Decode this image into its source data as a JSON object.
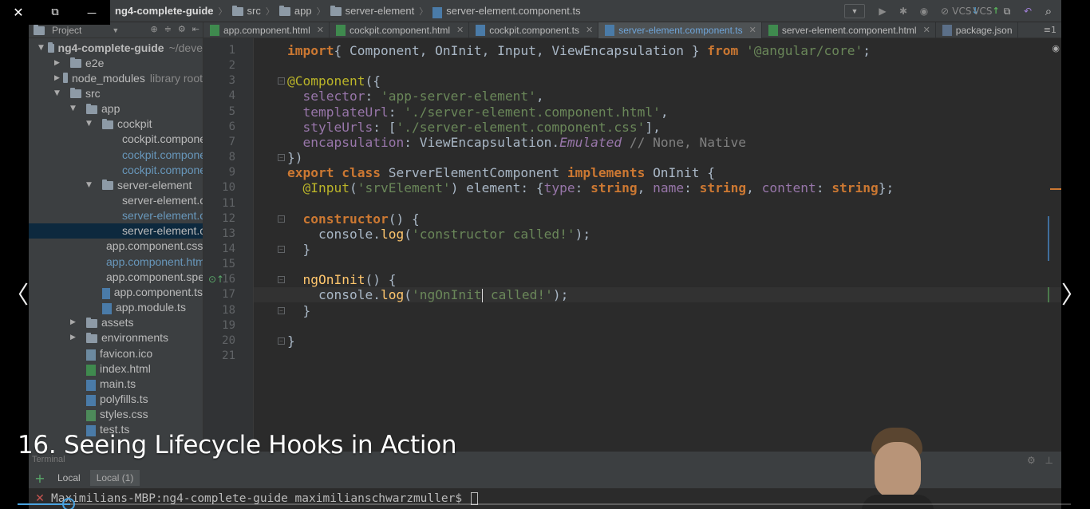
{
  "player": {
    "close_glyph": "✕",
    "restore_glyph": "⧉",
    "minimize_glyph": "—",
    "caption": "16. Seeing Lifecycle Hooks in Action",
    "progress_fraction": 0.05,
    "prev_glyph": "〈",
    "next_glyph": "〉"
  },
  "breadcrumb": {
    "project": "ng4-complete-guide",
    "items": [
      "src",
      "app",
      "server-element"
    ],
    "file": "server-element.component.ts"
  },
  "toolbar": {
    "vcs_label": "VCS"
  },
  "project_panel": {
    "title": "Project",
    "tree": [
      {
        "label": "ng4-complete-guide",
        "suffix": "~/deve",
        "arrow": "▼",
        "type": "folder"
      },
      {
        "label": "e2e",
        "arrow": "▶",
        "type": "folder"
      },
      {
        "label": "node_modules",
        "suffix": "library root",
        "arrow": "▶",
        "type": "folder"
      },
      {
        "label": "src",
        "arrow": "▼",
        "type": "folder"
      },
      {
        "label": "app",
        "arrow": "▼",
        "type": "folder"
      },
      {
        "label": "cockpit",
        "arrow": "▼",
        "type": "folder"
      },
      {
        "label": "cockpit.compone",
        "type": "css"
      },
      {
        "label": "cockpit.compone",
        "type": "html",
        "blue": true
      },
      {
        "label": "cockpit.compone",
        "type": "ts",
        "blue": true
      },
      {
        "label": "server-element",
        "arrow": "▼",
        "type": "folder"
      },
      {
        "label": "server-element.c",
        "type": "css"
      },
      {
        "label": "server-element.c",
        "type": "html",
        "blue": true
      },
      {
        "label": "server-element.c",
        "type": "ts",
        "selected": true
      },
      {
        "label": "app.component.css",
        "type": "css"
      },
      {
        "label": "app.component.htm",
        "type": "html",
        "blue": true
      },
      {
        "label": "app.component.spe",
        "type": "ts"
      },
      {
        "label": "app.component.ts",
        "type": "ts"
      },
      {
        "label": "app.module.ts",
        "type": "ts"
      },
      {
        "label": "assets",
        "arrow": "▶",
        "type": "folder"
      },
      {
        "label": "environments",
        "arrow": "▶",
        "type": "folder"
      },
      {
        "label": "favicon.ico",
        "type": "file"
      },
      {
        "label": "index.html",
        "type": "html"
      },
      {
        "label": "main.ts",
        "type": "ts"
      },
      {
        "label": "polyfills.ts",
        "type": "ts"
      },
      {
        "label": "styles.css",
        "type": "css"
      },
      {
        "label": "test.ts",
        "type": "ts"
      }
    ]
  },
  "tabs": [
    {
      "label": "app.component.html",
      "type": "html"
    },
    {
      "label": "cockpit.component.html",
      "type": "html"
    },
    {
      "label": "cockpit.component.ts",
      "type": "ts"
    },
    {
      "label": "server-element.component.ts",
      "type": "ts",
      "active": true
    },
    {
      "label": "server-element.component.html",
      "type": "html"
    },
    {
      "label": "package.json",
      "type": "json"
    }
  ],
  "tabs_more": "≡1",
  "code": [
    [
      [
        "kw",
        "import"
      ],
      [
        "",
        "{ Component, OnInit, Input, ViewEncapsulation } "
      ],
      [
        "kw",
        "from "
      ],
      [
        "str",
        "'@angular/core'"
      ],
      [
        "",
        ";"
      ]
    ],
    [],
    [
      [
        "dec",
        "@Component"
      ],
      [
        "",
        "({"
      ]
    ],
    [
      [
        "",
        "  "
      ],
      [
        "prop",
        "selector"
      ],
      [
        "",
        ": "
      ],
      [
        "str",
        "'app-server-element'"
      ],
      [
        "",
        ","
      ]
    ],
    [
      [
        "",
        "  "
      ],
      [
        "prop",
        "templateUrl"
      ],
      [
        "",
        ": "
      ],
      [
        "str",
        "'./server-element.component.html'"
      ],
      [
        "",
        ","
      ]
    ],
    [
      [
        "",
        "  "
      ],
      [
        "prop",
        "styleUrls"
      ],
      [
        "",
        ": ["
      ],
      [
        "str",
        "'./server-element.component.css'"
      ],
      [
        "",
        "],"
      ]
    ],
    [
      [
        "",
        "  "
      ],
      [
        "prop",
        "encapsulation"
      ],
      [
        "",
        ": ViewEncapsulation."
      ],
      [
        "it",
        "Emulated"
      ],
      [
        "cm",
        " // None, Native"
      ]
    ],
    [
      [
        "",
        "})"
      ]
    ],
    [
      [
        "kw",
        "export class "
      ],
      [
        "",
        "ServerElementComponent "
      ],
      [
        "kw",
        "implements "
      ],
      [
        "",
        "OnInit {"
      ]
    ],
    [
      [
        "",
        "  "
      ],
      [
        "dec",
        "@Input"
      ],
      [
        "",
        "("
      ],
      [
        "str",
        "'srvElement'"
      ],
      [
        "",
        ") element: {"
      ],
      [
        "prop",
        "type"
      ],
      [
        "",
        ": "
      ],
      [
        "type",
        "string"
      ],
      [
        "",
        ", "
      ],
      [
        "prop",
        "name"
      ],
      [
        "",
        ": "
      ],
      [
        "type",
        "string"
      ],
      [
        "",
        ", "
      ],
      [
        "prop",
        "content"
      ],
      [
        "",
        ": "
      ],
      [
        "type",
        "string"
      ],
      [
        "",
        "};"
      ]
    ],
    [],
    [
      [
        "",
        "  "
      ],
      [
        "kw",
        "constructor"
      ],
      [
        "",
        "() {"
      ]
    ],
    [
      [
        "",
        "    console."
      ],
      [
        "fn",
        "log"
      ],
      [
        "",
        "("
      ],
      [
        "str",
        "'constructor called!'"
      ],
      [
        "",
        ");"
      ]
    ],
    [
      [
        "",
        "  }"
      ]
    ],
    [],
    [
      [
        "",
        "  "
      ],
      [
        "fn",
        "ngOnInit"
      ],
      [
        "",
        "() {"
      ]
    ],
    [
      [
        "",
        "    console."
      ],
      [
        "fn",
        "log"
      ],
      [
        "",
        "("
      ],
      [
        "str",
        "'ngOnInit"
      ],
      [
        "caret",
        ""
      ],
      [
        "str",
        " called!'"
      ],
      [
        "",
        ");"
      ]
    ],
    [
      [
        "",
        "  }"
      ]
    ],
    [],
    [
      [
        "",
        "}"
      ]
    ],
    []
  ],
  "terminal": {
    "header": "Terminal",
    "tabs": [
      "Local",
      "Local (1)"
    ],
    "prompt": "Maximilians-MBP:ng4-complete-guide maximilianschwarzmuller$ "
  }
}
